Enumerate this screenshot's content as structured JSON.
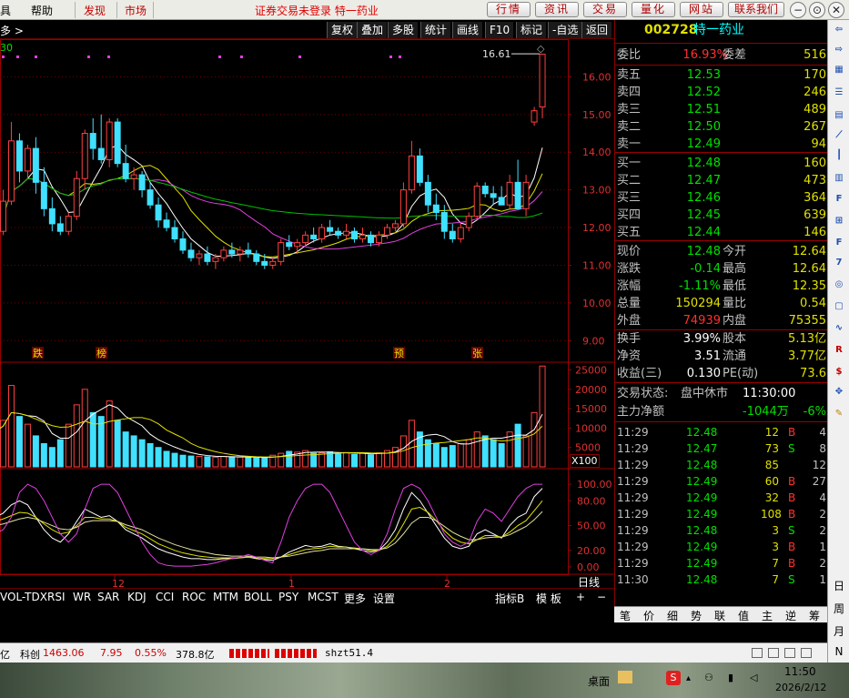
{
  "menubar": {
    "items": [
      "具",
      "帮助",
      "发现",
      "市场"
    ],
    "title": "证券交易未登录 特一药业",
    "tabs": [
      "行情",
      "资讯",
      "交易",
      "量化",
      "网站",
      "联系我们"
    ],
    "win": [
      "−",
      "⊙",
      "✕"
    ]
  },
  "toolbar": {
    "left_label": "多 >",
    "buttons": [
      "复权",
      "叠加",
      "多股",
      "统计",
      "画线",
      "F10",
      "标记",
      "-自选",
      "返回"
    ]
  },
  "chart": {
    "ma_label": "30",
    "price_ticks": [
      "16.00",
      "15.00",
      "14.00",
      "13.00",
      "12.00",
      "11.00",
      "10.00",
      "9.00"
    ],
    "high_label": "16.61",
    "events": [
      "跌",
      "榜",
      "预",
      "张"
    ],
    "vol_ticks": [
      "25000",
      "20000",
      "15000",
      "10000",
      "5000"
    ],
    "vol_unit": "X100",
    "ind_ticks": [
      "100.00",
      "80.00",
      "50.00",
      "20.00",
      "0.00"
    ],
    "date_labels": [
      "12",
      "1",
      "2"
    ],
    "period": "日线"
  },
  "chart_data": {
    "type": "candlestick",
    "ylim": [
      8.5,
      17.0
    ],
    "ohlc": [
      [
        11.6,
        12.1,
        11.4,
        11.9
      ],
      [
        11.9,
        13.0,
        11.8,
        12.7
      ],
      [
        12.7,
        14.8,
        12.6,
        14.3
      ],
      [
        14.3,
        14.5,
        13.2,
        13.5
      ],
      [
        13.5,
        14.2,
        13.3,
        14.1
      ],
      [
        14.1,
        14.4,
        12.9,
        13.2
      ],
      [
        13.2,
        13.6,
        12.3,
        12.5
      ],
      [
        12.5,
        12.8,
        11.9,
        12.1
      ],
      [
        12.1,
        12.3,
        11.8,
        11.9
      ],
      [
        11.9,
        12.4,
        11.8,
        12.3
      ],
      [
        12.3,
        13.5,
        12.2,
        13.3
      ],
      [
        13.3,
        14.6,
        13.0,
        14.5
      ],
      [
        14.5,
        14.9,
        13.8,
        14.1
      ],
      [
        14.1,
        15.0,
        13.7,
        13.8
      ],
      [
        13.8,
        14.9,
        13.6,
        14.8
      ],
      [
        14.8,
        14.9,
        13.6,
        13.7
      ],
      [
        13.7,
        14.2,
        13.2,
        13.3
      ],
      [
        13.3,
        13.6,
        13.0,
        13.4
      ],
      [
        13.4,
        13.5,
        12.8,
        13.0
      ],
      [
        13.0,
        13.2,
        12.5,
        12.6
      ],
      [
        12.6,
        12.8,
        12.0,
        12.2
      ],
      [
        12.2,
        12.4,
        11.9,
        12.0
      ],
      [
        12.0,
        12.2,
        11.6,
        11.7
      ],
      [
        11.7,
        11.9,
        11.3,
        11.4
      ],
      [
        11.4,
        11.6,
        11.1,
        11.2
      ],
      [
        11.2,
        11.4,
        11.0,
        11.3
      ],
      [
        11.3,
        11.5,
        11.0,
        11.1
      ],
      [
        11.1,
        11.3,
        10.9,
        11.2
      ],
      [
        11.2,
        11.5,
        11.1,
        11.4
      ],
      [
        11.4,
        11.6,
        11.2,
        11.3
      ],
      [
        11.3,
        11.5,
        11.1,
        11.4
      ],
      [
        11.4,
        11.6,
        11.2,
        11.3
      ],
      [
        11.3,
        11.4,
        11.0,
        11.1
      ],
      [
        11.1,
        11.3,
        10.9,
        11.0
      ],
      [
        11.0,
        11.2,
        10.9,
        11.1
      ],
      [
        11.1,
        11.7,
        11.0,
        11.6
      ],
      [
        11.6,
        11.8,
        11.4,
        11.5
      ],
      [
        11.5,
        11.7,
        11.3,
        11.6
      ],
      [
        11.6,
        11.9,
        11.5,
        11.8
      ],
      [
        11.8,
        12.0,
        11.6,
        11.7
      ],
      [
        11.7,
        12.1,
        11.6,
        12.0
      ],
      [
        12.0,
        12.2,
        11.8,
        11.9
      ],
      [
        11.9,
        12.0,
        11.7,
        11.8
      ],
      [
        11.8,
        12.1,
        11.7,
        11.9
      ],
      [
        11.9,
        12.0,
        11.6,
        11.7
      ],
      [
        11.7,
        12.0,
        11.6,
        11.8
      ],
      [
        11.8,
        11.9,
        11.5,
        11.6
      ],
      [
        11.6,
        11.9,
        11.5,
        11.8
      ],
      [
        11.8,
        12.1,
        11.7,
        12.0
      ],
      [
        12.0,
        12.2,
        11.9,
        12.1
      ],
      [
        12.1,
        13.2,
        12.0,
        13.0
      ],
      [
        13.0,
        14.3,
        12.9,
        13.9
      ],
      [
        13.9,
        14.1,
        13.1,
        13.2
      ],
      [
        13.2,
        13.4,
        12.4,
        12.6
      ],
      [
        12.6,
        12.9,
        12.2,
        12.4
      ],
      [
        12.4,
        12.6,
        11.7,
        11.9
      ],
      [
        11.9,
        12.1,
        11.6,
        11.7
      ],
      [
        11.7,
        12.1,
        11.6,
        12.0
      ],
      [
        12.0,
        12.4,
        11.9,
        12.3
      ],
      [
        12.3,
        13.2,
        12.2,
        13.1
      ],
      [
        13.1,
        13.2,
        12.8,
        12.9
      ],
      [
        12.9,
        13.1,
        12.6,
        12.8
      ],
      [
        12.8,
        13.1,
        12.6,
        12.6
      ],
      [
        12.6,
        13.4,
        12.5,
        13.2
      ],
      [
        13.2,
        13.8,
        13.0,
        12.5
      ],
      [
        12.5,
        13.4,
        12.3,
        13.2
      ],
      [
        14.8,
        15.2,
        14.7,
        15.1
      ],
      [
        15.2,
        16.61,
        14.9,
        16.6
      ]
    ],
    "volume": [
      9000,
      12000,
      21000,
      13000,
      11000,
      8000,
      6000,
      5000,
      7000,
      11000,
      16000,
      20000,
      14000,
      13000,
      17000,
      12000,
      9000,
      8000,
      7000,
      6000,
      5000,
      4000,
      3500,
      3000,
      2800,
      2700,
      2600,
      2500,
      2700,
      2600,
      2500,
      2400,
      2300,
      2300,
      3000,
      3500,
      4000,
      3800,
      4200,
      3500,
      3600,
      3900,
      3300,
      3700,
      3200,
      3500,
      3100,
      3600,
      4200,
      5000,
      8000,
      12000,
      9000,
      7000,
      6000,
      5000,
      5500,
      6000,
      7000,
      9000,
      8000,
      7000,
      6000,
      9000,
      11000,
      8000,
      14000,
      26000
    ],
    "volume_colors": [
      "r",
      "r",
      "r",
      "c",
      "r",
      "c",
      "c",
      "c",
      "c",
      "r",
      "r",
      "r",
      "c",
      "c",
      "r",
      "c",
      "c",
      "c",
      "c",
      "c",
      "c",
      "c",
      "c",
      "c",
      "c",
      "r",
      "c",
      "r",
      "r",
      "c",
      "r",
      "c",
      "c",
      "c",
      "r",
      "r",
      "c",
      "r",
      "r",
      "c",
      "r",
      "c",
      "c",
      "r",
      "c",
      "r",
      "c",
      "r",
      "r",
      "r",
      "r",
      "r",
      "c",
      "c",
      "c",
      "c",
      "c",
      "r",
      "r",
      "r",
      "c",
      "c",
      "c",
      "r",
      "c",
      "r",
      "r",
      "r"
    ],
    "series": [
      {
        "values": [
          60,
          65,
          75,
          80,
          75,
          60,
          45,
          35,
          30,
          40,
          55,
          70,
          65,
          60,
          62,
          55,
          45,
          40,
          35,
          28,
          22,
          18,
          15,
          12,
          10,
          10,
          9,
          9,
          10,
          10,
          11,
          12,
          10,
          9,
          8,
          12,
          18,
          22,
          26,
          24,
          25,
          28,
          25,
          24,
          22,
          20,
          18,
          20,
          30,
          45,
          70,
          90,
          80,
          65,
          50,
          35,
          25,
          22,
          25,
          40,
          45,
          40,
          35,
          50,
          60,
          65,
          85,
          95
        ]
      },
      {
        "values": [
          55,
          58,
          62,
          66,
          65,
          60,
          52,
          45,
          40,
          42,
          50,
          60,
          60,
          58,
          58,
          55,
          48,
          44,
          40,
          34,
          28,
          24,
          20,
          17,
          15,
          13,
          12,
          11,
          11,
          11,
          11,
          12,
          11,
          10,
          10,
          12,
          15,
          18,
          21,
          22,
          23,
          25,
          24,
          24,
          23,
          22,
          20,
          20,
          25,
          35,
          52,
          70,
          72,
          66,
          56,
          44,
          35,
          30,
          28,
          33,
          38,
          38,
          36,
          42,
          50,
          56,
          68,
          80
        ]
      },
      {
        "values": [
          50,
          52,
          55,
          58,
          60,
          58,
          54,
          50,
          46,
          45,
          48,
          54,
          56,
          56,
          56,
          55,
          51,
          48,
          45,
          40,
          35,
          31,
          27,
          24,
          21,
          19,
          17,
          15,
          14,
          13,
          13,
          13,
          12,
          12,
          11,
          12,
          13,
          15,
          17,
          19,
          20,
          22,
          22,
          22,
          22,
          22,
          21,
          21,
          23,
          29,
          40,
          53,
          60,
          60,
          56,
          49,
          42,
          37,
          33,
          33,
          35,
          36,
          36,
          39,
          44,
          49,
          57,
          67
        ]
      },
      {
        "values": [
          40,
          45,
          60,
          90,
          100,
          95,
          80,
          60,
          40,
          30,
          40,
          70,
          95,
          100,
          100,
          90,
          70,
          50,
          30,
          15,
          5,
          2,
          1,
          1,
          1,
          2,
          3,
          5,
          8,
          10,
          12,
          15,
          12,
          8,
          5,
          30,
          60,
          80,
          95,
          100,
          100,
          90,
          70,
          50,
          30,
          20,
          15,
          20,
          40,
          70,
          95,
          100,
          95,
          80,
          60,
          40,
          30,
          25,
          30,
          55,
          70,
          65,
          55,
          70,
          85,
          95,
          100,
          100
        ]
      }
    ]
  },
  "bottomtabs": [
    "VOL-TDX",
    "RSI",
    "WR",
    "SAR",
    "KDJ",
    "CCI",
    "ROC",
    "MTM",
    "BOLL",
    "PSY",
    "MCST",
    "更多",
    "设置",
    "指标B",
    "模 板",
    "+",
    "−"
  ],
  "panel": {
    "code": "002728",
    "name": "特一药业",
    "weibi_label": "委比",
    "weibi": "16.93%",
    "weicha_label": "委差",
    "weicha": "516",
    "asks": [
      {
        "label": "卖五",
        "price": "12.53",
        "vol": "170"
      },
      {
        "label": "卖四",
        "price": "12.52",
        "vol": "246"
      },
      {
        "label": "卖三",
        "price": "12.51",
        "vol": "489"
      },
      {
        "label": "卖二",
        "price": "12.50",
        "vol": "267"
      },
      {
        "label": "卖一",
        "price": "12.49",
        "vol": "94"
      }
    ],
    "bids": [
      {
        "label": "买一",
        "price": "12.48",
        "vol": "160"
      },
      {
        "label": "买二",
        "price": "12.47",
        "vol": "473"
      },
      {
        "label": "买三",
        "price": "12.46",
        "vol": "364"
      },
      {
        "label": "买四",
        "price": "12.45",
        "vol": "639"
      },
      {
        "label": "买五",
        "price": "12.44",
        "vol": "146"
      }
    ],
    "stats": [
      {
        "l1": "现价",
        "v1": "12.48",
        "c1": "grn",
        "l2": "今开",
        "v2": "12.64",
        "c2": "red"
      },
      {
        "l1": "涨跌",
        "v1": "-0.14",
        "c1": "grn",
        "l2": "最高",
        "v2": "12.64",
        "c2": "red"
      },
      {
        "l1": "涨幅",
        "v1": "-1.11%",
        "c1": "grn",
        "l2": "最低",
        "v2": "12.35",
        "c2": "grn"
      },
      {
        "l1": "总量",
        "v1": "150294",
        "c1": "yel",
        "l2": "量比",
        "v2": "0.54",
        "c2": "yel"
      },
      {
        "l1": "外盘",
        "v1": "74939",
        "c1": "red",
        "l2": "内盘",
        "v2": "75355",
        "c2": "grn"
      }
    ],
    "info": [
      {
        "l1": "换手",
        "v1": "3.99%",
        "l2": "股本",
        "v2": "5.13亿"
      },
      {
        "l1": "净资",
        "v1": "3.51",
        "l2": "流通",
        "v2": "3.77亿"
      },
      {
        "l1": "收益(三)",
        "v1": "0.130",
        "l2": "PE(动)",
        "v2": "73.6"
      }
    ],
    "trade_state_label": "交易状态:",
    "trade_state": "盘中休市",
    "trade_time": "11:30:00",
    "netflow_label": "主力净额",
    "netflow": "-1044万",
    "netflow_pct": "-6%",
    "ticks": [
      {
        "t": "11:29",
        "p": "12.48",
        "q": "12",
        "s": "B",
        "n": "4"
      },
      {
        "t": "11:29",
        "p": "12.47",
        "q": "73",
        "s": "S",
        "n": "8"
      },
      {
        "t": "11:29",
        "p": "12.48",
        "q": "85",
        "s": "",
        "n": "12"
      },
      {
        "t": "11:29",
        "p": "12.49",
        "q": "60",
        "s": "B",
        "n": "27"
      },
      {
        "t": "11:29",
        "p": "12.49",
        "q": "32",
        "s": "B",
        "n": "4"
      },
      {
        "t": "11:29",
        "p": "12.49",
        "q": "108",
        "s": "B",
        "n": "2"
      },
      {
        "t": "11:29",
        "p": "12.48",
        "q": "3",
        "s": "S",
        "n": "2"
      },
      {
        "t": "11:29",
        "p": "12.49",
        "q": "3",
        "s": "B",
        "n": "1"
      },
      {
        "t": "11:29",
        "p": "12.49",
        "q": "7",
        "s": "B",
        "n": "2"
      },
      {
        "t": "11:30",
        "p": "12.48",
        "q": "7",
        "s": "S",
        "n": "1"
      }
    ]
  },
  "rtabs": [
    "笔",
    "价",
    "细",
    "势",
    "联",
    "值",
    "主",
    "逆",
    "筹"
  ],
  "righttool": {
    "vtext": [
      "日",
      "周",
      "月",
      "N"
    ]
  },
  "status": {
    "a": "亿",
    "kc_label": "科创",
    "kc_val": "1463.06",
    "kc_chg": "7.95",
    "kc_pct": "0.55%",
    "kc_amt": "378.8亿",
    "src": "shzt51.4"
  },
  "taskbar": {
    "desk": "桌面",
    "time": "11:50",
    "date": "2026/2/12"
  }
}
